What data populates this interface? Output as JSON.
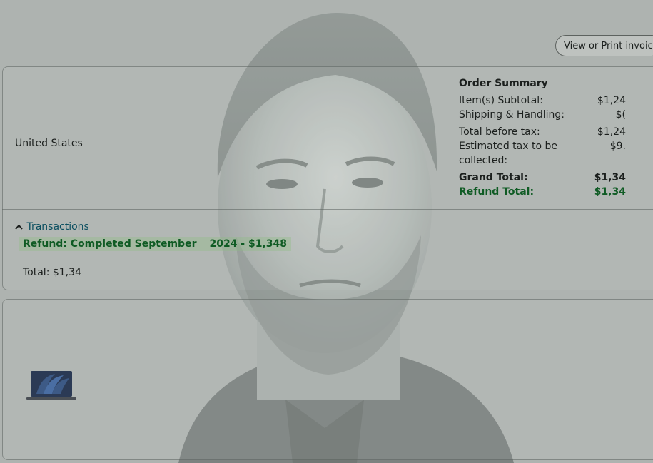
{
  "header": {
    "invoice_button": "View or Print invoice"
  },
  "address": {
    "country": "United States"
  },
  "order_summary": {
    "title": "Order Summary",
    "rows": [
      {
        "label": "Item(s) Subtotal:",
        "value": "$1,24"
      },
      {
        "label": "Shipping & Handling:",
        "value": "$("
      },
      {
        "label": "Total before tax:",
        "value": "$1,24"
      },
      {
        "label": "Estimated tax to be",
        "label2": "collected:",
        "value": "$9."
      },
      {
        "label": "Grand Total:",
        "value": "$1,34"
      },
      {
        "label": "Refund Total:",
        "value": "$1,34"
      }
    ]
  },
  "transactions": {
    "toggle_label": "Transactions",
    "refund_part1": "Refund: Completed September",
    "refund_part2": "2024 - $1,348",
    "total": "Total: $1,34"
  },
  "item": {
    "thumbnail_icon": "laptop-icon"
  }
}
